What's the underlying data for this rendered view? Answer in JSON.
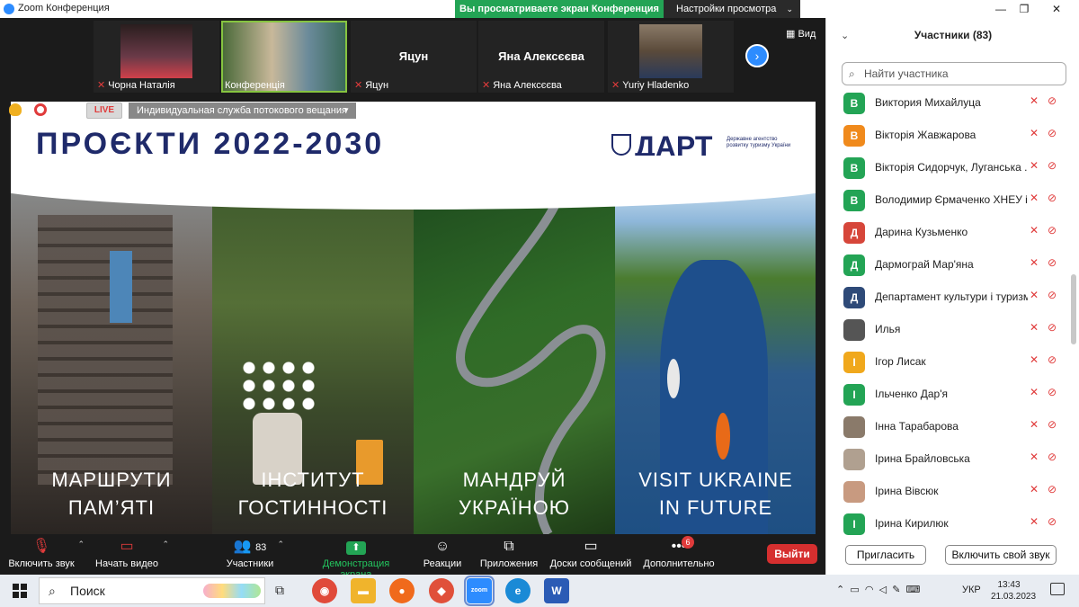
{
  "window": {
    "title": "Zoom Конференция",
    "share_banner": "Вы просматриваете экран Конференция",
    "view_settings": "Настройки просмотра",
    "controls": [
      "—",
      "❐",
      "✕"
    ]
  },
  "video_strip": {
    "tiles": [
      {
        "name": "Чорна Наталія",
        "muted": true,
        "label_center": ""
      },
      {
        "name": "Конференція",
        "muted": false,
        "label_center": ""
      },
      {
        "name": "Яцун",
        "muted": true,
        "label_center": "Яцун"
      },
      {
        "name": "Яна Алексєєва",
        "muted": true,
        "label_center": "Яна Алексєєва"
      },
      {
        "name": "Yuriy Hladenko",
        "muted": true,
        "label_center": ""
      }
    ],
    "view_label": "Вид"
  },
  "share": {
    "live": "LIVE",
    "stream_service": "Индивидуальная служба потокового вещания",
    "slide": {
      "title": "ПРОЄКТИ 2022-2030",
      "logo_word": "ДАРТ",
      "logo_sub": "Державне агентство розвитку туризму України",
      "panels": [
        {
          "line1": "МАРШРУТИ",
          "line2": "ПАМ’ЯТІ"
        },
        {
          "line1": "ІНСТИТУТ",
          "line2": "ГОСТИННОСТІ"
        },
        {
          "line1": "МАНДРУЙ",
          "line2": "УКРАЇНОЮ"
        },
        {
          "line1": "VISIT UKRAINE",
          "line2": "IN FUTURE"
        }
      ]
    }
  },
  "toolbar": {
    "unmute": "Включить звук",
    "start_video": "Начать видео",
    "participants": "Участники",
    "participants_count": "83",
    "share_screen": "Демонстрация экрана",
    "reactions": "Реакции",
    "apps": "Приложения",
    "whiteboards": "Доски сообщений",
    "more": "Дополнительно",
    "more_badge": "6",
    "leave": "Выйти"
  },
  "participants_panel": {
    "title": "Участники (83)",
    "search_placeholder": "Найти участника",
    "participants": [
      {
        "initial": "В",
        "color": "#23a455",
        "name": "Виктория Михайлуца"
      },
      {
        "initial": "В",
        "color": "#f08a1c",
        "name": "Вікторія Жавжарова"
      },
      {
        "initial": "В",
        "color": "#23a455",
        "name": "Вікторія Сидорчук, Луганська ..."
      },
      {
        "initial": "В",
        "color": "#23a455",
        "name": "Володимир Єрмаченко ХНЕУ і..."
      },
      {
        "initial": "Д",
        "color": "#d6463a",
        "name": "Дарина Кузьменко"
      },
      {
        "initial": "Д",
        "color": "#23a455",
        "name": "Дармограй Мар'яна"
      },
      {
        "initial": "Д",
        "color": "#2e4a78",
        "name": "Департамент культури і туризму П..."
      },
      {
        "initial": "",
        "color": "#555555",
        "name": "Илья"
      },
      {
        "initial": "І",
        "color": "#f0a81c",
        "name": "Ігор Лисак"
      },
      {
        "initial": "І",
        "color": "#23a455",
        "name": "Ільченко Дар'я"
      },
      {
        "initial": "",
        "color": "#8a7a6a",
        "name": "Інна Тарабарова"
      },
      {
        "initial": "",
        "color": "#b0a090",
        "name": "Ірина Брайловська"
      },
      {
        "initial": "",
        "color": "#c89a80",
        "name": "Ірина Вівсюк"
      },
      {
        "initial": "І",
        "color": "#23a455",
        "name": "Ірина Кирилюк"
      }
    ],
    "invite": "Пригласить",
    "unmute_self": "Включить свой звук"
  },
  "taskbar": {
    "search": "Поиск",
    "lang": "УКР",
    "time": "13:43",
    "date": "21.03.2023",
    "apps": [
      {
        "name": "chrome",
        "label": "◉",
        "color": "#e04a3a"
      },
      {
        "name": "explorer",
        "label": "▬",
        "color": "#f0b42c"
      },
      {
        "name": "firefox",
        "label": "●",
        "color": "#f06a1c"
      },
      {
        "name": "app",
        "label": "◆",
        "color": "#e0503a"
      },
      {
        "name": "zoom",
        "label": "zoom",
        "color": "#2d8cff"
      },
      {
        "name": "edge",
        "label": "e",
        "color": "#1a8ad6"
      },
      {
        "name": "word",
        "label": "W",
        "color": "#2b5bb5"
      }
    ]
  }
}
